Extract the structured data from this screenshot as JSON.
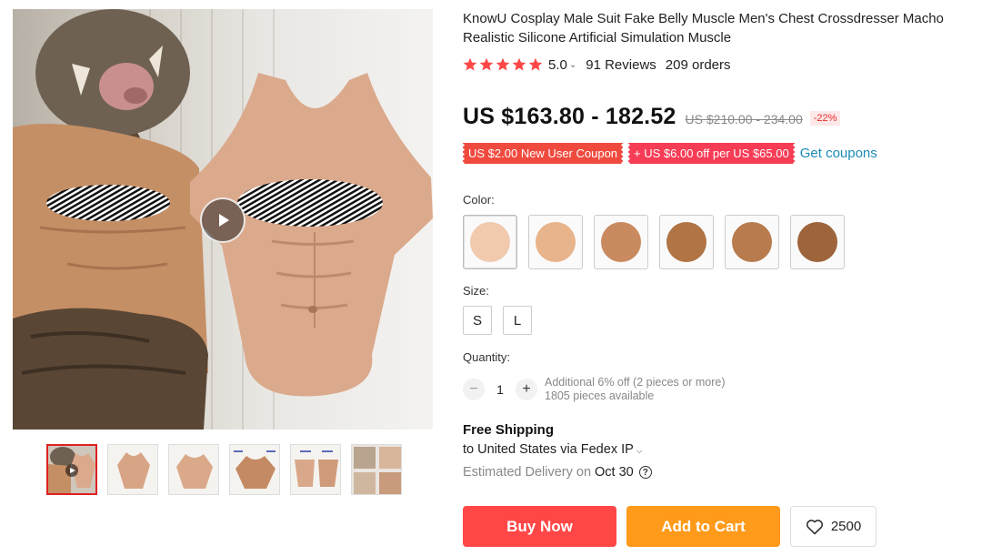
{
  "product": {
    "title": "KnowU Cosplay Male Suit Fake Belly Muscle Men's Chest Crossdresser Macho Realistic Silicone Artificial Simulation Muscle",
    "rating": "5.0",
    "reviews": "91 Reviews",
    "orders": "209 orders",
    "price": "US $163.80 - 182.52",
    "original_price": "US $210.00 - 234.00",
    "discount": "-22%"
  },
  "coupons": {
    "new_user": "US $2.00 New User Coupon",
    "store": "+ US $6.00 off per US $65.00",
    "get_label": "Get coupons"
  },
  "color": {
    "label": "Color:",
    "swatches": [
      "#f1c9ad",
      "#e8b48c",
      "#c98a5f",
      "#b07445",
      "#b87b4d",
      "#9e643c"
    ]
  },
  "size": {
    "label": "Size:",
    "options": [
      "S",
      "L"
    ]
  },
  "quantity": {
    "label": "Quantity:",
    "value": "1",
    "minus": "−",
    "plus": "+",
    "note1": "Additional 6% off (2 pieces or more)",
    "note2": "1805 pieces available"
  },
  "shipping": {
    "title": "Free Shipping",
    "to": "to United States via Fedex IP",
    "eta_label": "Estimated Delivery on",
    "eta_date": "Oct 30",
    "help": "?"
  },
  "actions": {
    "buy": "Buy Now",
    "cart": "Add to Cart",
    "wishlist_count": "2500"
  },
  "colors": {
    "star": "#ff4747",
    "buy": "#ff4747",
    "cart": "#ff9a1a",
    "link": "#1b8ab5"
  }
}
